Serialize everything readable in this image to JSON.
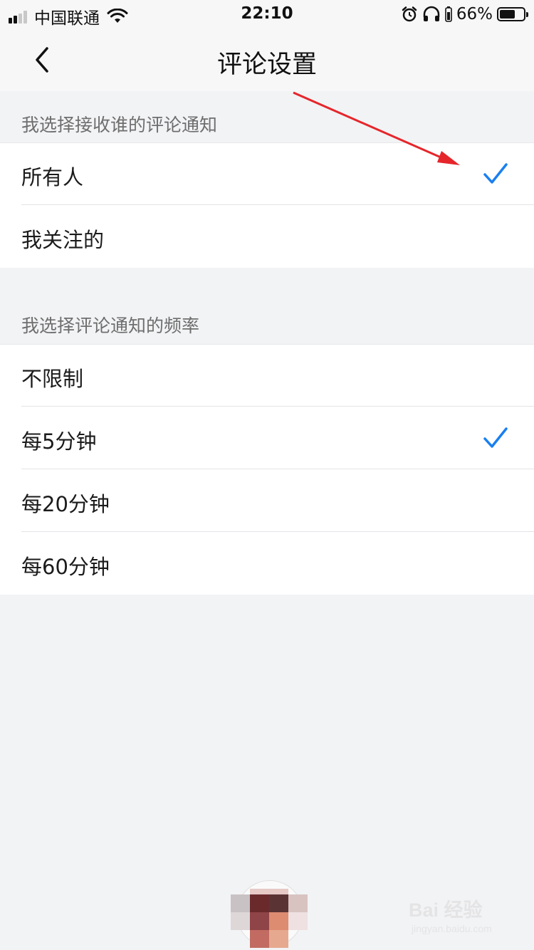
{
  "status_bar": {
    "carrier": "中国联通",
    "time": "22:10",
    "battery_percent": "66%",
    "battery_level": 0.66,
    "icons": [
      "signal-icon",
      "wifi-icon",
      "alarm-icon",
      "headphones-icon",
      "battery-icon"
    ]
  },
  "nav": {
    "title": "评论设置",
    "back_icon": "chevron-left-icon"
  },
  "sections": [
    {
      "header": "我选择接收谁的评论通知",
      "options": [
        {
          "label": "所有人",
          "selected": true
        },
        {
          "label": "我关注的",
          "selected": false
        }
      ]
    },
    {
      "header": "我选择评论通知的频率",
      "options": [
        {
          "label": "不限制",
          "selected": false
        },
        {
          "label": "每5分钟",
          "selected": true
        },
        {
          "label": "每20分钟",
          "selected": false
        },
        {
          "label": "每60分钟",
          "selected": false
        }
      ]
    }
  ],
  "watermark": {
    "brand": "Bai 经验",
    "sub": "jingyan.baidu.com"
  },
  "colors": {
    "accent_check": "#1a7ff0",
    "annotation_arrow": "#e5262b",
    "background": "#f2f3f5"
  }
}
